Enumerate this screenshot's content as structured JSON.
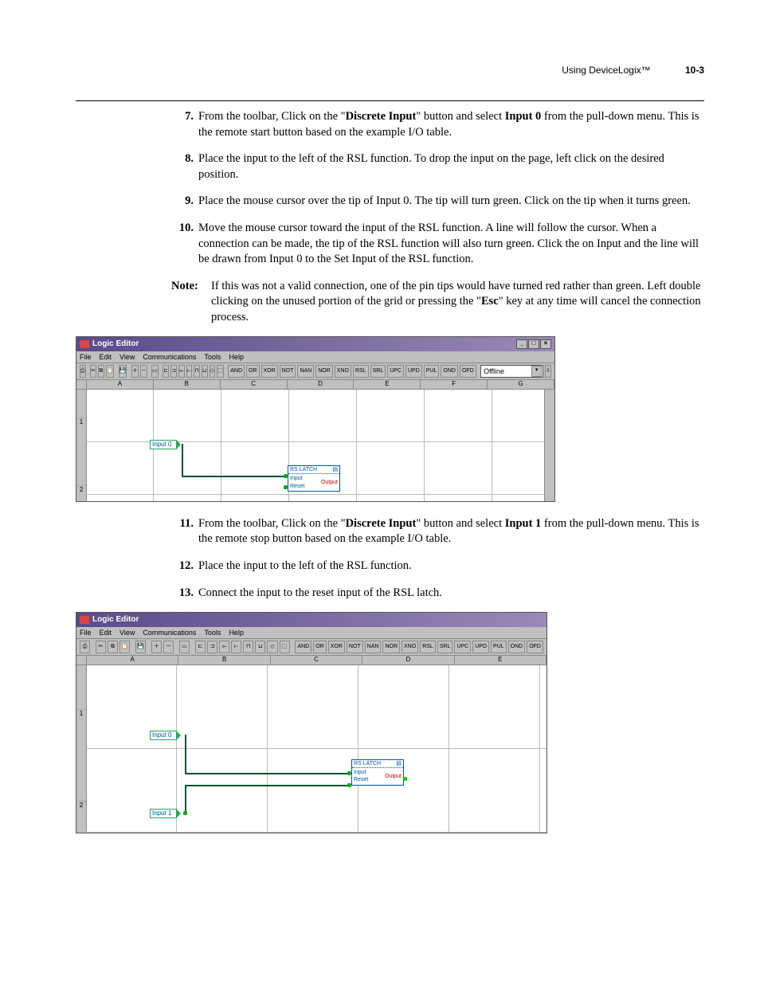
{
  "running_head": {
    "title": "Using DeviceLogix™",
    "pageno": "10-3"
  },
  "steps_a": [
    {
      "n": "7.",
      "pre": "From the toolbar, Click on the \"",
      "b1": "Discrete Input",
      "mid": "\" button and select ",
      "b2": "Input 0",
      "post": " from the pull-down menu. This is the remote start button based on the example I/O table."
    },
    {
      "n": "8.",
      "plain": "Place the input to the left of the RSL function. To drop the input on the page, left click on the desired position."
    },
    {
      "n": "9.",
      "plain": "Place the mouse cursor over the tip of Input 0. The tip will turn green. Click on the tip when it turns green."
    },
    {
      "n": "10.",
      "plain": "Move the mouse cursor toward the input of the RSL function. A line will follow the cursor. When a connection can be made, the tip of the RSL function will also turn green. Click the on Input and the line will be drawn from Input 0 to the Set Input of the RSL function."
    }
  ],
  "note": {
    "label": "Note:",
    "pre": "If this was not a valid connection, one of the pin tips would have turned red rather than green. Left double clicking on the unused portion of the grid or pressing the \"",
    "b": "Esc",
    "post": "\" key at any time will cancel the connection process."
  },
  "steps_b": [
    {
      "n": "11.",
      "pre": "From the toolbar, Click on the \"",
      "b1": "Discrete Input",
      "mid": "\" button and select ",
      "b2": "Input 1",
      "post": " from the pull-down menu. This is the remote stop button based on the example I/O table."
    },
    {
      "n": "12.",
      "plain": "Place the input to the left of the RSL function."
    },
    {
      "n": "13.",
      "plain": "Connect the input to the reset input of the RSL latch."
    }
  ],
  "editor": {
    "title": "Logic Editor",
    "menus": [
      "File",
      "Edit",
      "View",
      "Communications",
      "Tools",
      "Help"
    ],
    "gates": [
      "AND",
      "OR",
      "XOR",
      "NOT",
      "NAN",
      "NOR",
      "XNO",
      "RSL",
      "SRL",
      "UPC",
      "UPD",
      "PUL",
      "OND",
      "OFD"
    ],
    "status_combo": "Offline",
    "cols1": [
      "A",
      "B",
      "C",
      "D",
      "E",
      "F",
      "G"
    ],
    "cols2": [
      "A",
      "B",
      "C",
      "D",
      "E"
    ],
    "block_title": "RS LATCH",
    "port_input": "Input",
    "port_reset": "Reset",
    "port_output": "Output",
    "input0": "Input 0",
    "input1": "Input 1",
    "row1": "1",
    "row2": "2"
  }
}
